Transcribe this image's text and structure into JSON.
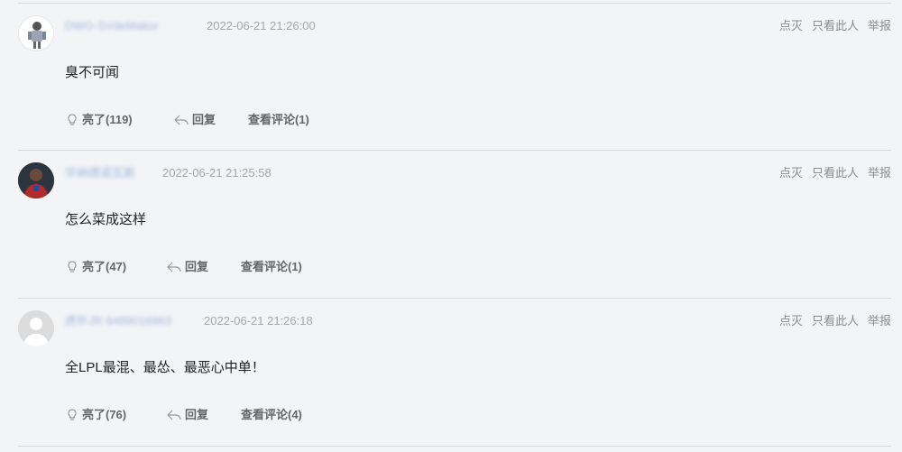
{
  "comments": [
    {
      "username": "DWO·SVdeMakor",
      "time": "2022-06-21 21:26:00",
      "text": "臭不可闻",
      "ops": [
        "点灭",
        "只看此人",
        "举报"
      ],
      "like_label": "亮了(119)",
      "reply_label": "回复",
      "view_label": "查看评论(1)"
    },
    {
      "username": "华纳德诺瓦斯",
      "time": "2022-06-21 21:25:58",
      "text": "怎么菜成这样",
      "ops": [
        "点灭",
        "只看此人",
        "举报"
      ],
      "like_label": "亮了(47)",
      "reply_label": "回复",
      "view_label": "查看评论(1)"
    },
    {
      "username": "虎扑JR 6489016963",
      "time": "2022-06-21 21:26:18",
      "text": "全LPL最混、最怂、最恶心中单！",
      "ops": [
        "点灭",
        "只看此人",
        "举报"
      ],
      "like_label": "亮了(76)",
      "reply_label": "回复",
      "view_label": "查看评论(4)"
    }
  ]
}
